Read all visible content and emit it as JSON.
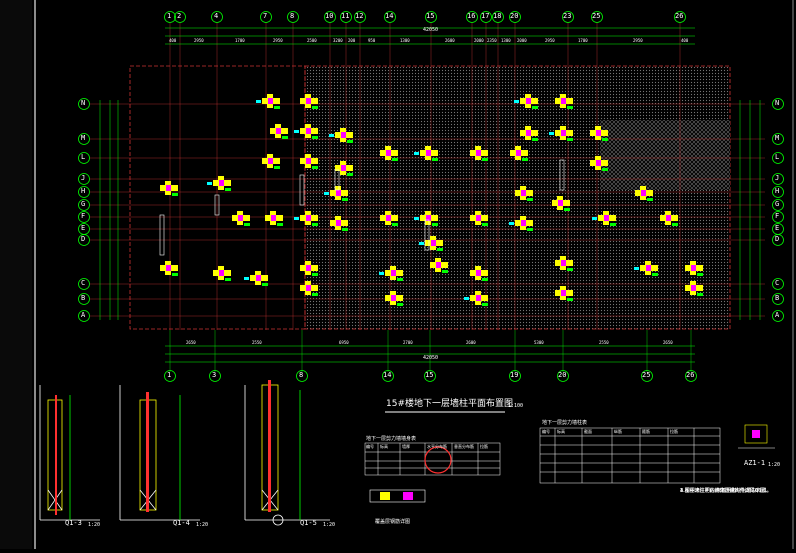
{
  "plan": {
    "title": "15#楼地下一层墙柱平面布置图",
    "title_scale": "1:100",
    "top_axes": [
      "1",
      "2",
      "4",
      "7",
      "8",
      "10",
      "11",
      "12",
      "14",
      "15",
      "16",
      "17",
      "18",
      "20",
      "23",
      "25",
      "26"
    ],
    "bottom_axes": [
      "1",
      "3",
      "8",
      "14",
      "15",
      "19",
      "20",
      "25",
      "26"
    ],
    "left_axes": [
      "N",
      "M",
      "L",
      "J",
      "H",
      "G",
      "F",
      "E",
      "D",
      "C",
      "B",
      "A"
    ],
    "right_axes": [
      "N",
      "M",
      "L",
      "J",
      "H",
      "G",
      "F",
      "E",
      "D",
      "C",
      "B",
      "A"
    ],
    "overall_dim": "42050",
    "top_dims": [
      "400",
      "2950",
      "1700",
      "2950",
      "2500",
      "3200",
      "200",
      "950",
      "1300",
      "2600",
      "2000",
      "2350",
      "1300",
      "2000",
      "2950",
      "1700",
      "2950",
      "400"
    ],
    "bottom_dims": [
      "2650",
      "2550",
      "6950",
      "2700",
      "2600",
      "5300",
      "2550",
      "2650"
    ]
  },
  "details": {
    "q13": "Q1-3",
    "q14": "Q1-4",
    "q15": "Q1-5",
    "az11": "AZ1-1",
    "detail_scale": "1:20",
    "slab_note": "覆盖层钢筋详图"
  },
  "tables": {
    "wall_table_title": "地下一层剪力墙墙身表",
    "wall_headers": [
      "编号",
      "标高",
      "墙厚",
      "水平分布筋",
      "垂直分布筋",
      "拉筋"
    ],
    "col_table_title": "地下一层剪力墙柱表",
    "col_headers": [
      "编号",
      "标高",
      "截面",
      "纵筋",
      "箍筋",
      "拉筋"
    ]
  },
  "notes": {
    "lines": [
      "1.本图墙柱定位,未注明者均为居中布置。",
      "2.图中未注明的墙体厚度均为200。",
      "3.图中未注明的约束边缘构件详见Q1-1。",
      "4.图中未注明的构造边缘构件详见本图。"
    ]
  },
  "colors": {
    "background": "#000000",
    "axis_bubble": "#ffffff",
    "dim_line": "#00ff00",
    "grid_axis": "#cc3333",
    "column_yellow": "#ffff00",
    "column_magenta": "#ff00ff",
    "hatch": "#808080",
    "cyan": "#00ffff",
    "highlight_circle": "#ff3030"
  }
}
